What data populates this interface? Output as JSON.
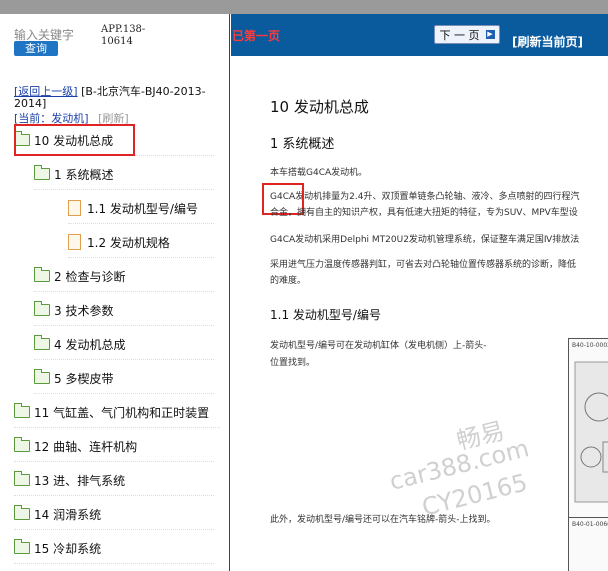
{
  "sidebar": {
    "search_label": "输入关键字",
    "search_button": "查询",
    "app_code": "APP.138-10614",
    "back_link": "[返回上一级]",
    "breadcrumb": "[B-北京汽车-BJ40-2013-2014]",
    "current_label": "[当前：发动机]",
    "refresh_label": "[刷新]",
    "items": [
      {
        "label": "10 发动机总成",
        "type": "folder",
        "highlighted": true
      },
      {
        "label": "1 系统概述",
        "type": "folder"
      },
      {
        "label": "1.1 发动机型号/编号",
        "type": "doc"
      },
      {
        "label": "1.2 发动机规格",
        "type": "doc"
      },
      {
        "label": "2 检查与诊断",
        "type": "folder"
      },
      {
        "label": "3 技术参数",
        "type": "folder"
      },
      {
        "label": "4 发动机总成",
        "type": "folder"
      },
      {
        "label": "5 多楔皮带",
        "type": "folder"
      },
      {
        "label": "11 气缸盖、气门机构和正时装置",
        "type": "folder"
      },
      {
        "label": "12 曲轴、连杆机构",
        "type": "folder"
      },
      {
        "label": "13 进、排气系统",
        "type": "folder"
      },
      {
        "label": "14 润滑系统",
        "type": "folder"
      },
      {
        "label": "15 冷却系统",
        "type": "folder"
      }
    ]
  },
  "header": {
    "left_text": "已第一页",
    "next_button": "下 一 页",
    "refresh_button": "[刷新当前页]"
  },
  "content": {
    "title": "10 发动机总成",
    "section1": "1 系统概述",
    "p1": "本车搭载G4CA发动机。",
    "p2_highlight": "G4CA",
    "p2_line1": "发动机排量为2.4升、双顶置单链条凸轮轴、液冷、多点喷射的四行程汽",
    "p2_line2": "合金，拥有自主的知识产权，具有低速大扭矩的特征，专为SUV、MPV车型设",
    "p3": "G4CA发动机采用Delphi MT20U2发动机管理系统，保证整车满足国Ⅳ排放法",
    "p4_line1": "采用进气压力温度传感器判缸，可省去对凸轮轴位置传感器系统的诊断，降低",
    "p4_line2": "的难度。",
    "subsection": "1.1 发动机型号/编号",
    "p5_line1": "发动机型号/编号可在发动机缸体（发电机侧）上-箭头-",
    "p5_line2": "位置找到。",
    "p6": "此外，发动机型号/编号还可以在汽车铭牌-箭头-上找到。",
    "fig1_label": "B40-10-0002",
    "fig2_label": "B40-01-0066"
  },
  "watermark": {
    "line1": "畅易",
    "line2": "car388.com",
    "line3": "CY20165"
  },
  "colors": {
    "accent_blue": "#0a5b9e",
    "highlight_red": "#e02424",
    "link_blue": "#1a3fa8"
  }
}
